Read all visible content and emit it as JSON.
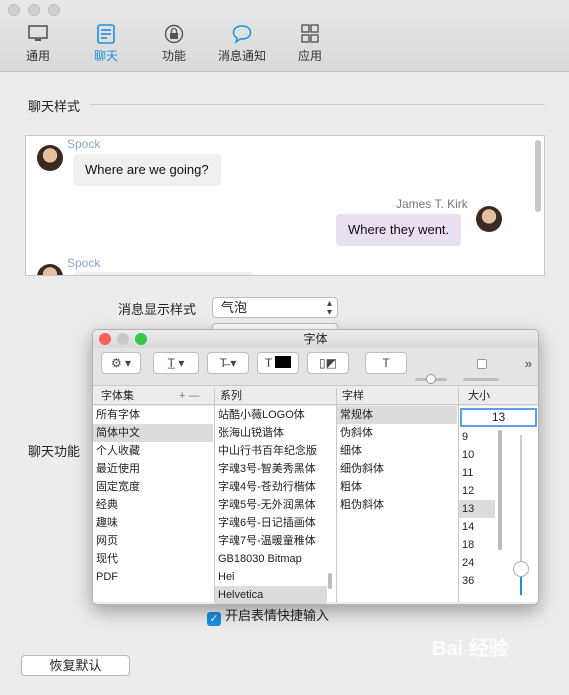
{
  "toolbar": {
    "items": [
      {
        "label": "通用",
        "icon": "monitor-icon"
      },
      {
        "label": "聊天",
        "icon": "chat-list-icon"
      },
      {
        "label": "功能",
        "icon": "lock-icon"
      },
      {
        "label": "消息通知",
        "icon": "speech-bubble-icon"
      },
      {
        "label": "应用",
        "icon": "grid-icon"
      }
    ],
    "active": "聊天"
  },
  "chat_style": {
    "title": "聊天样式",
    "messages": [
      {
        "sender": "Spock",
        "text": "Where are we going?"
      },
      {
        "sender": "James T. Kirk",
        "text": "Where they went."
      },
      {
        "sender": "Spock",
        "text": ""
      }
    ]
  },
  "message_display": {
    "label": "消息显示样式",
    "value": "气泡"
  },
  "chat_features": {
    "label": "聊天功能"
  },
  "emoji_shortcut": {
    "label": "开启表情快捷输入",
    "checked": true
  },
  "restore_button": "恢复默认",
  "font_panel": {
    "title": "字体",
    "columns": {
      "collection": "字体集",
      "family": "系列",
      "typeface": "字样",
      "size": "大小"
    },
    "collection_controls": "+ —",
    "collections": [
      "所有字体",
      "简体中文",
      "个人收藏",
      "最近使用",
      "固定宽度",
      "经典",
      "趣味",
      "网页",
      "现代",
      "PDF"
    ],
    "collection_selected": "简体中文",
    "families": [
      "站酷小薇LOGO体",
      "张海山锐谐体",
      "中山行书百年纪念版",
      "字魂3号-智美秀黑体",
      "字魂4号-苍劲行楷体",
      "字魂5号-无外润黑体",
      "字魂6号-日记插画体",
      "字魂7号-温暖童稚体",
      "GB18030 Bitmap",
      "Hei",
      "Helvetica"
    ],
    "family_selected": "Helvetica",
    "typefaces": [
      "常规体",
      "伪斜体",
      "细体",
      "细伪斜体",
      "粗体",
      "粗伪斜体"
    ],
    "typeface_selected": "常规体",
    "size_value": "13",
    "sizes": [
      "9",
      "10",
      "11",
      "12",
      "13",
      "14",
      "18",
      "24",
      "36"
    ],
    "size_selected": "13",
    "toolbar_more": "»"
  },
  "watermark": "Bai 经验",
  "colors": {
    "accent": "#1b8fe0",
    "bubble_left": "#f0f0f0",
    "bubble_right": "#e8dff0"
  }
}
